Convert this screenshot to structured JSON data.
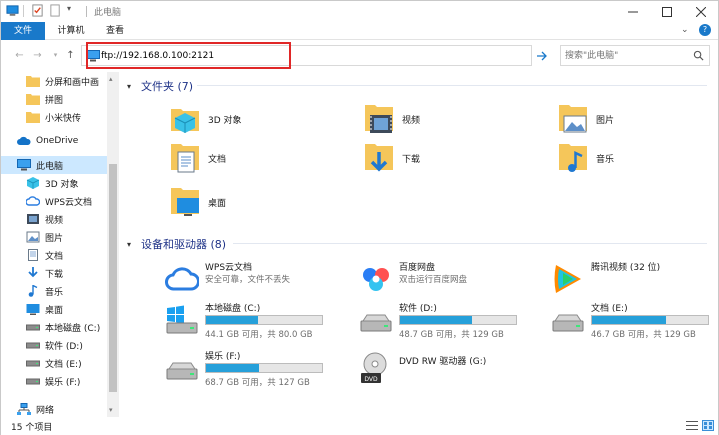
{
  "window": {
    "title": "此电脑"
  },
  "ribbon": {
    "tabs": [
      "文件",
      "计算机",
      "查看"
    ]
  },
  "address": {
    "value": "ftp://192.168.0.100:2121"
  },
  "search": {
    "placeholder": "搜索\"此电脑\""
  },
  "sidebar": {
    "items": [
      {
        "label": "分屏和画中画",
        "icon": "folder-icon"
      },
      {
        "label": "拼图",
        "icon": "folder-icon"
      },
      {
        "label": "小米快传",
        "icon": "folder-icon"
      },
      {
        "label": "OneDrive",
        "icon": "cloud-icon"
      },
      {
        "label": "此电脑",
        "icon": "computer-icon"
      },
      {
        "label": "3D 对象",
        "icon": "cube-icon"
      },
      {
        "label": "WPS云文档",
        "icon": "wps-cloud-icon"
      },
      {
        "label": "视频",
        "icon": "video-icon"
      },
      {
        "label": "图片",
        "icon": "picture-icon"
      },
      {
        "label": "文档",
        "icon": "document-icon"
      },
      {
        "label": "下载",
        "icon": "download-icon"
      },
      {
        "label": "音乐",
        "icon": "music-icon"
      },
      {
        "label": "桌面",
        "icon": "desktop-icon"
      },
      {
        "label": "本地磁盘 (C:)",
        "icon": "drive-icon"
      },
      {
        "label": "软件 (D:)",
        "icon": "drive-icon"
      },
      {
        "label": "文档 (E:)",
        "icon": "drive-icon"
      },
      {
        "label": "娱乐 (F:)",
        "icon": "drive-icon"
      },
      {
        "label": "网络",
        "icon": "network-icon"
      }
    ]
  },
  "folders": {
    "header": "文件夹 (7)",
    "items": [
      {
        "label": "3D 对象",
        "icon": "cube-folder-icon"
      },
      {
        "label": "视频",
        "icon": "video-folder-icon"
      },
      {
        "label": "图片",
        "icon": "picture-folder-icon"
      },
      {
        "label": "文档",
        "icon": "document-folder-icon"
      },
      {
        "label": "下载",
        "icon": "download-folder-icon"
      },
      {
        "label": "音乐",
        "icon": "music-folder-icon"
      },
      {
        "label": "桌面",
        "icon": "desktop-folder-icon"
      }
    ]
  },
  "devices": {
    "header": "设备和驱动器 (8)",
    "apps": [
      {
        "name": "WPS云文档",
        "sub": "安全可靠，文件不丢失",
        "icon": "wps-cloud-icon"
      },
      {
        "name": "百度网盘",
        "sub": "双击运行百度网盘",
        "icon": "baidu-netdisk-icon"
      },
      {
        "name": "腾讯视频 (32 位)",
        "sub": "",
        "icon": "tencent-video-icon"
      }
    ],
    "drives": [
      {
        "name": "本地磁盘 (C:)",
        "size": "44.1 GB 可用，共 80.0 GB",
        "used": 0.45,
        "icon": "windows-drive-icon"
      },
      {
        "name": "软件 (D:)",
        "size": "48.7 GB 可用，共 129 GB",
        "used": 0.62,
        "icon": "drive-icon"
      },
      {
        "name": "文档 (E:)",
        "size": "46.7 GB 可用，共 129 GB",
        "used": 0.64,
        "icon": "drive-icon"
      },
      {
        "name": "娱乐 (F:)",
        "size": "68.7 GB 可用，共 127 GB",
        "used": 0.46,
        "icon": "drive-icon"
      },
      {
        "name": "DVD RW 驱动器 (G:)",
        "icon": "dvd-drive-icon"
      }
    ]
  },
  "status": {
    "count": "15 个项目"
  },
  "colors": {
    "accent": "#1979ca",
    "selection": "#cce8ff",
    "bar": "#26a0da",
    "highlight": "#e02727"
  }
}
